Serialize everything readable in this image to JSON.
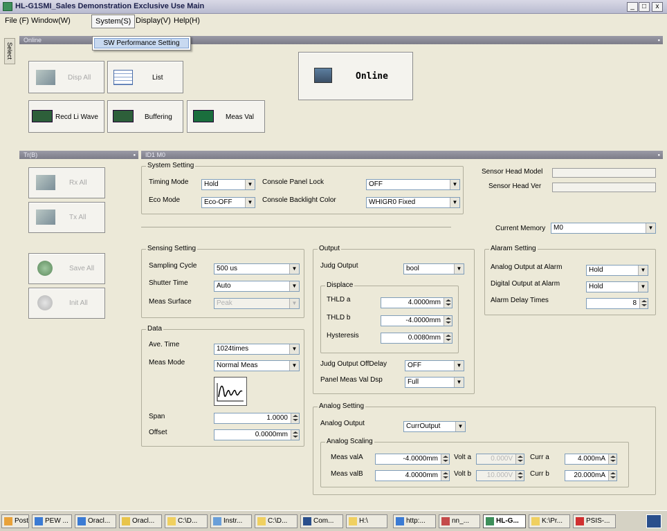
{
  "window": {
    "title": "HL-G1SMI_Sales Demonstration Exclusive Use Main",
    "min_label": "_",
    "max_label": "□",
    "close_label": "x"
  },
  "menu": {
    "items": [
      "File (F)",
      "Window(W)",
      "System(S)",
      "Display(V)",
      "Help(H)"
    ],
    "dropdown_item": "SW Performance Setting"
  },
  "side_tab": "Select",
  "online_panel": {
    "header": "Online",
    "buttons": {
      "disp_all": "Disp All",
      "list": "List",
      "online": "Online",
      "recd_li_wave": "Recd Li Wave",
      "buffering": "Buffering",
      "meas_val": "Meas Val"
    }
  },
  "left_panel": {
    "header": "Tr(B)",
    "buttons": [
      "Rx All",
      "Tx All",
      "Save All",
      "Init All"
    ]
  },
  "main_panel": {
    "header": "ID1 M0",
    "system_setting": {
      "title": "System Setting",
      "timing_mode_label": "Timing Mode",
      "timing_mode_value": "Hold",
      "eco_mode_label": "Eco Mode",
      "eco_mode_value": "Eco-OFF",
      "console_lock_label": "Console Panel Lock",
      "console_lock_value": "OFF",
      "backlight_label": "Console Backlight Color",
      "backlight_value": "WHIGR0 Fixed"
    },
    "sensor": {
      "model_label": "Sensor Head Model",
      "ver_label": "Sensor Head Ver",
      "memory_label": "Current Memory",
      "memory_value": "M0"
    },
    "sensing_setting": {
      "title": "Sensing Setting",
      "sampling_label": "Sampling Cycle",
      "sampling_value": "500 us",
      "shutter_label": "Shutter Time",
      "shutter_value": "Auto",
      "surface_label": "Meas Surface",
      "surface_value": "Peak"
    },
    "data": {
      "title": "Data",
      "ave_label": "Ave. Time",
      "ave_value": "1024times",
      "mode_label": "Meas Mode",
      "mode_value": "Normal Meas",
      "span_label": "Span",
      "span_value": "1.0000",
      "offset_label": "Offset",
      "offset_value": "0.0000mm"
    },
    "output": {
      "title": "Output",
      "judge_label": "Judg Output",
      "judge_value": "bool",
      "displace_title": "Displace",
      "thld_a_label": "THLD a",
      "thld_a_value": "4.0000mm",
      "thld_b_label": "THLD b",
      "thld_b_value": "-4.0000mm",
      "hyst_label": "Hysteresis",
      "hyst_value": "0.0080mm",
      "offdelay_label": "Judg Output OffDelay",
      "offdelay_value": "OFF",
      "panel_disp_label": "Panel Meas Val Dsp",
      "panel_disp_value": "Full"
    },
    "alarm": {
      "title": "Alaram Setting",
      "analog_label": "Analog Output at Alarm",
      "analog_value": "Hold",
      "digital_label": "Digital Output at Alarm",
      "digital_value": "Hold",
      "delay_label": "Alarm Delay Times",
      "delay_value": "8"
    },
    "analog": {
      "title": "Analog Setting",
      "output_label": "Analog Output",
      "output_value": "CurrOutput",
      "scaling_title": "Analog Scaling",
      "meas_a_label": "Meas valA",
      "meas_a_value": "-4.0000mm",
      "volt_a_label": "Volt a",
      "volt_a_value": "0.000V",
      "curr_a_label": "Curr a",
      "curr_a_value": "4.000mA",
      "meas_b_label": "Meas valB",
      "meas_b_value": "4.0000mm",
      "volt_b_label": "Volt b",
      "volt_b_value": "10.000V",
      "curr_b_label": "Curr b",
      "curr_b_value": "20.000mA"
    }
  },
  "taskbar": {
    "items": [
      "Post...",
      "PEW ...",
      "Oracl...",
      "Oracl...",
      "C:\\D...",
      "Instr...",
      "C:\\D...",
      "Com...",
      "H:\\",
      "http:...",
      "nn_...",
      "HL-G...",
      "K:\\Pr...",
      "PSIS-..."
    ]
  }
}
